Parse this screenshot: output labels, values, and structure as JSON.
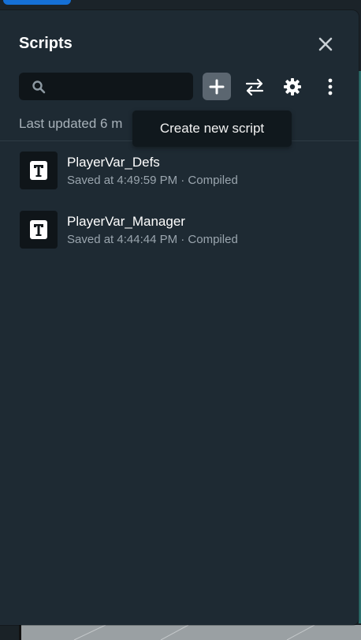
{
  "panel": {
    "title": "Scripts",
    "close_icon": "close-icon"
  },
  "toolbar": {
    "search_placeholder": "",
    "search_value": "",
    "add_icon": "plus-icon",
    "swap_icon": "swap-arrows-icon",
    "settings_icon": "gear-icon",
    "more_icon": "kebab-menu-icon"
  },
  "status": {
    "last_updated": "Last updated 6 m"
  },
  "tooltip": {
    "text": "Create new script"
  },
  "scripts": [
    {
      "name": "PlayerVar_Defs",
      "meta": "Saved at 4:49:59 PM · Compiled",
      "icon": "text-script-icon"
    },
    {
      "name": "PlayerVar_Manager",
      "meta": "Saved at 4:44:44 PM · Compiled",
      "icon": "text-script-icon"
    }
  ],
  "colors": {
    "panel_bg": "#1e2a33",
    "input_bg": "#0f1519",
    "accent": "#1570d6",
    "active_button": "#5b6670"
  }
}
